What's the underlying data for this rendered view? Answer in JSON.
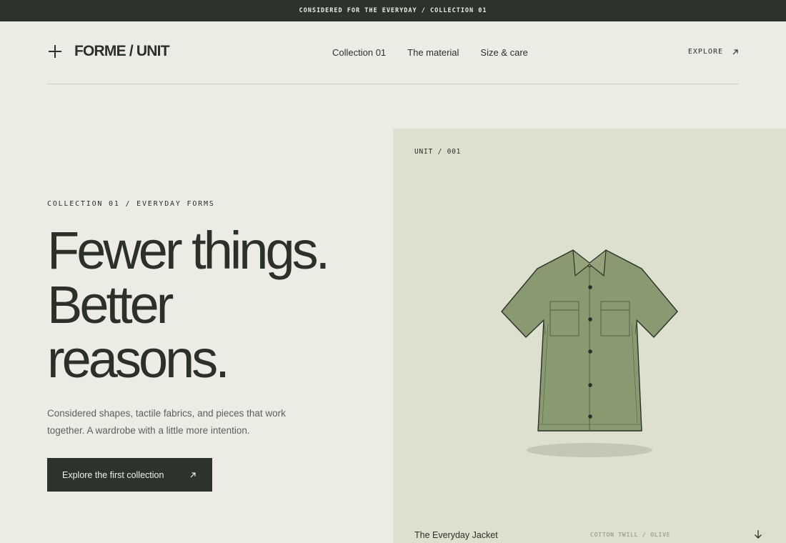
{
  "announcement": "CONSIDERED FOR THE EVERYDAY / COLLECTION 01",
  "brand": {
    "name": "FORME / UNIT",
    "icon": "plus-icon"
  },
  "nav": {
    "items": [
      {
        "label": "Collection 01"
      },
      {
        "label": "The material"
      },
      {
        "label": "Size & care"
      }
    ],
    "explore_label": "EXPLORE"
  },
  "hero": {
    "eyebrow": "COLLECTION 01 / EVERYDAY FORMS",
    "headline": [
      "Fewer things.",
      "Better",
      "reasons."
    ],
    "lede": "Considered shapes, tactile fabrics, and pieces that work together. A wardrobe with a little more intention.",
    "cta_label": "Explore the first collection"
  },
  "product": {
    "unit_label": "UNIT / 001",
    "name": "The Everyday Jacket",
    "meta": "COTTON TWILL / OLIVE",
    "colors": {
      "card": "#dce0cd",
      "garment": "#8a9a70",
      "outline": "#2b302a"
    }
  },
  "colors": {
    "ink": "#2b302a",
    "background": "#ecece5",
    "bar": "#2c332c"
  }
}
